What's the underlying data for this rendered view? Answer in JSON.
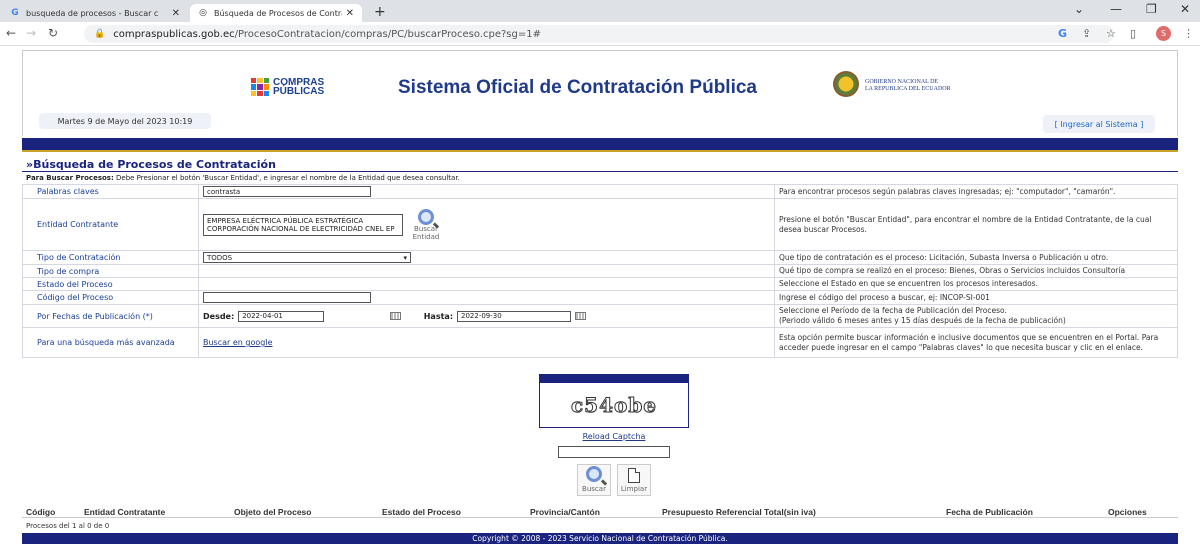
{
  "browser": {
    "tabs": [
      {
        "title": "busqueda de procesos - Buscar c",
        "favicon": "G"
      },
      {
        "title": "Búsqueda de Procesos de Contra",
        "favicon": "globe"
      }
    ],
    "url_host": "compraspublicas.gob.ec",
    "url_path": "/ProcesoContratacion/compras/PC/buscarProceso.cpe?sg=1#",
    "profile_initial": "S"
  },
  "header": {
    "logo_line1": "COMPRAS",
    "logo_line2": "PÚBLICAS",
    "site_title": "Sistema Oficial de Contratación Pública",
    "gov_line1": "GOBIERNO NACIONAL DE",
    "gov_line2": "LA REPUBLICA DEL ECUADOR",
    "date": "Martes 9 de Mayo del 2023 10:19",
    "login": "[ Ingresar al Sistema ]"
  },
  "section": {
    "title": "»Búsqueda de Procesos de Contratación",
    "instr_bold": "Para Buscar Procesos:",
    "instr_rest": " Debe Presionar el botón 'Buscar Entidad', e ingresar el nombre de la Entidad que desea consultar."
  },
  "form": {
    "palabras_label": "Palabras claves",
    "palabras_value": "contrasta",
    "palabras_help": "Para encontrar procesos según palabras claves ingresadas; ej: \"computador\", \"camarón\".",
    "entidad_label": "Entidad Contratante",
    "entidad_value_1": "EMPRESA ELÉCTRICA PÚBLICA ESTRATÉGICA",
    "entidad_value_2": "CORPORACIÓN NACIONAL DE ELECTRICIDAD CNEL EP",
    "buscar_entidad_1": "Buscar",
    "buscar_entidad_2": "Entidad",
    "entidad_help": "Presione el botón \"Buscar Entidad\", para encontrar el nombre de la Entidad Contratante, de la cual desea buscar Procesos.",
    "tipo_label": "Tipo de Contratación",
    "tipo_value": "TODOS",
    "tipo_help": "Que tipo de contratación es el proceso: Licitación, Subasta Inversa o Publicación u otro.",
    "compra_label": "Tipo de compra",
    "compra_help": "Qué tipo de compra se realizó en el proceso: Bienes, Obras o Servicios incluidos Consultoría",
    "estado_label": "Estado del Proceso",
    "estado_help": "Seleccione el Estado en que se encuentren los procesos interesados.",
    "codigo_label": "Código del Proceso",
    "codigo_help": "Ingrese el código del proceso a buscar, ej: INCOP-SI-001",
    "fechas_label": "Por Fechas de Publicación (*)",
    "desde_label": "Desde:",
    "desde_value": "2022-04-01",
    "hasta_label": "Hasta:",
    "hasta_value": "2022-09-30",
    "fechas_help_1": "Seleccione el Período de la fecha de Publicación del Proceso.",
    "fechas_help_2": "(Periodo válido 6 meses antes y 15 días después de la fecha de publicación)",
    "avanzada_label": "Para una búsqueda más avanzada",
    "avanzada_link": "Buscar en google",
    "avanzada_help": "Esta opción permite buscar información e inclusive documentos que se encuentren en el Portal. Para acceder puede ingresar en el campo \"Palabras claves\" lo que necesita buscar y clic en el enlace."
  },
  "captcha": {
    "text": "c54obe",
    "reload": "Reload Captcha",
    "buscar": "Buscar",
    "limpiar": "Limpiar"
  },
  "results": {
    "columns": [
      "Código",
      "Entidad Contratante",
      "Objeto del Proceso",
      "Estado del Proceso",
      "Provincia/Cantón",
      "Presupuesto Referencial Total(sin iva)",
      "Fecha de Publicación",
      "Opciones"
    ],
    "count": "Procesos del 1 al 0 de 0"
  },
  "footer": "Copyright © 2008 - 2023 Servicio Nacional de Contratación Pública."
}
